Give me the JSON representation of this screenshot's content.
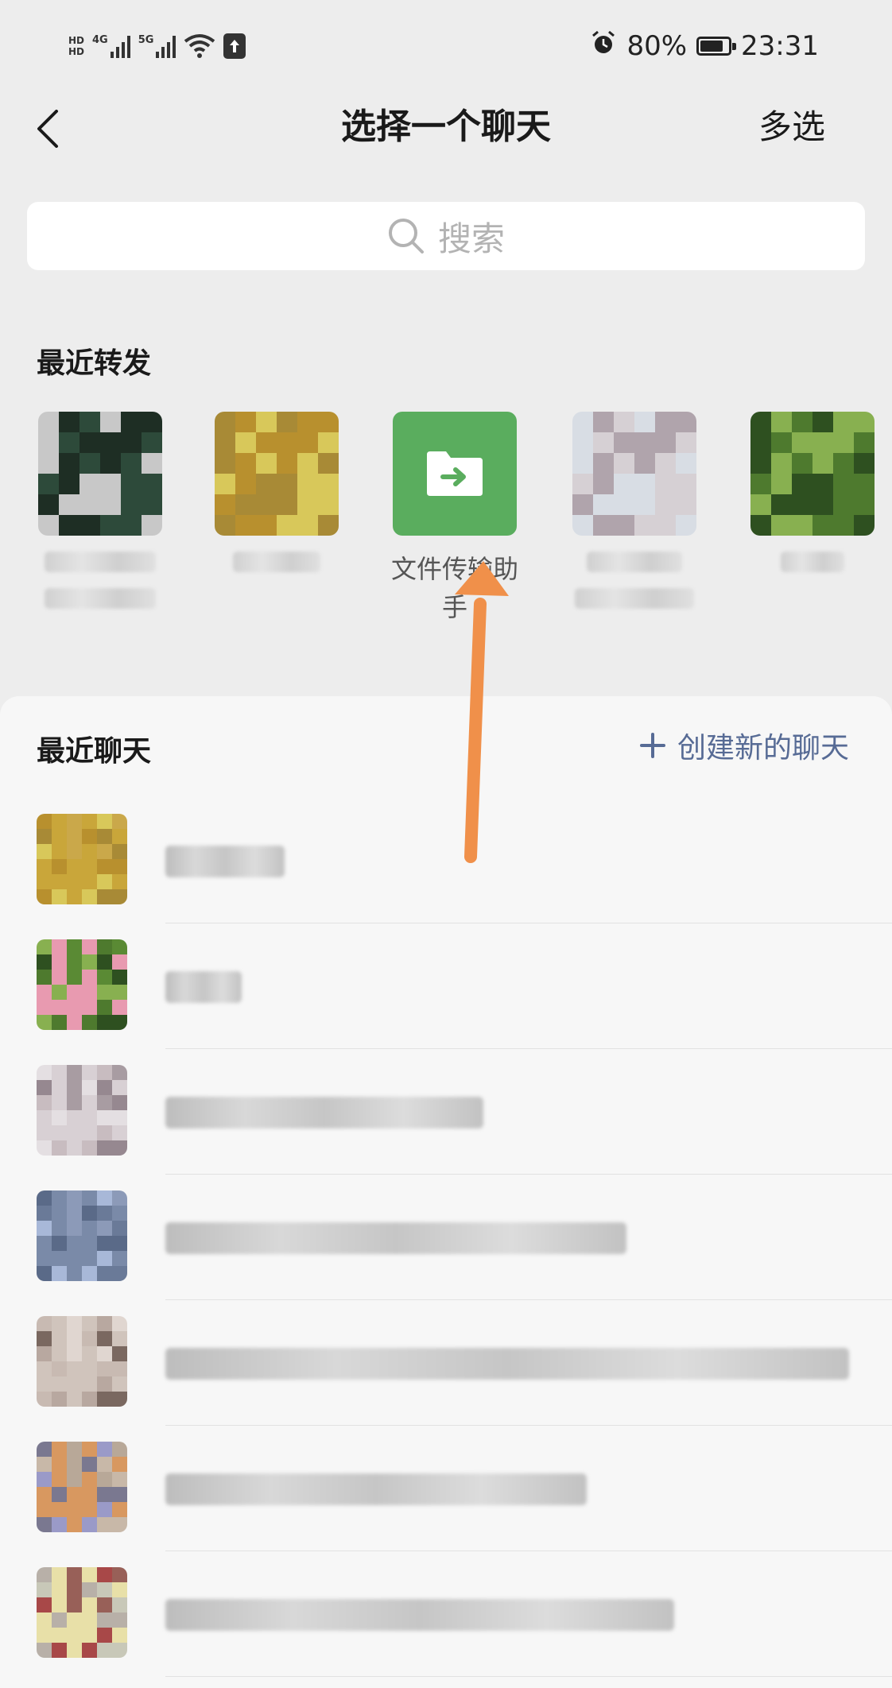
{
  "status_bar": {
    "hd_top": "HD",
    "hd_bottom": "HD",
    "net1": "4G",
    "net2": "5G",
    "battery_percent": "80%",
    "time": "23:31"
  },
  "nav": {
    "title": "选择一个聊天",
    "multi_select": "多选"
  },
  "search": {
    "placeholder": "搜索"
  },
  "recent_forward": {
    "title": "最近转发",
    "items": [
      {
        "name": ""
      },
      {
        "name": ""
      },
      {
        "name": "文件传输助手"
      },
      {
        "name": ""
      },
      {
        "name": ""
      }
    ]
  },
  "recent_chats": {
    "title": "最近聊天",
    "create_label": "创建新的聊天",
    "items": [
      {
        "name": ""
      },
      {
        "name": ""
      },
      {
        "name": ""
      },
      {
        "name": ""
      },
      {
        "name": ""
      },
      {
        "name": ""
      },
      {
        "name": ""
      }
    ]
  },
  "colors": {
    "file_helper_green": "#5aad5e",
    "link_blue": "#576b95",
    "annotation_orange": "#f0904a",
    "background": "#ededed"
  }
}
